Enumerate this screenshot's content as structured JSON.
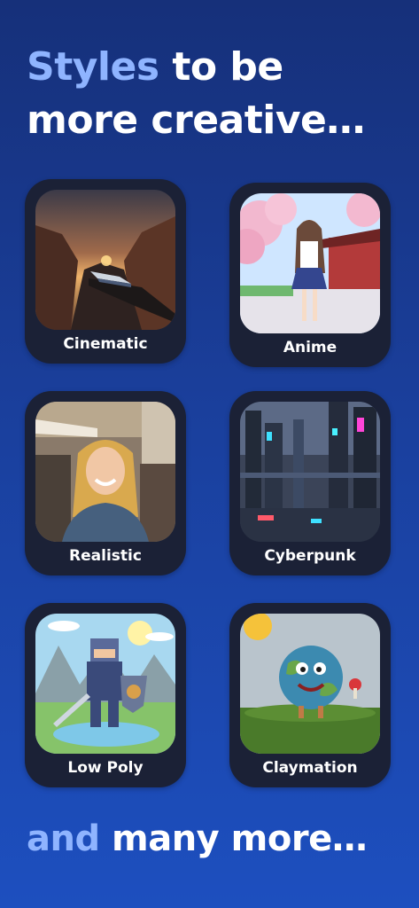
{
  "headline": {
    "accent": "Styles",
    "rest": " to be more creative…"
  },
  "styles": [
    {
      "label": "Cinematic",
      "image": "canyon-train-sunset-image"
    },
    {
      "label": "Anime",
      "image": "anime-girl-cherry-blossom-image"
    },
    {
      "label": "Realistic",
      "image": "smiling-woman-cafe-image"
    },
    {
      "label": "Cyberpunk",
      "image": "futuristic-city-image"
    },
    {
      "label": "Low Poly",
      "image": "voxel-knight-image"
    },
    {
      "label": "Claymation",
      "image": "clay-earth-character-image"
    }
  ],
  "footer": {
    "accent": "and",
    "rest": " many more…"
  }
}
